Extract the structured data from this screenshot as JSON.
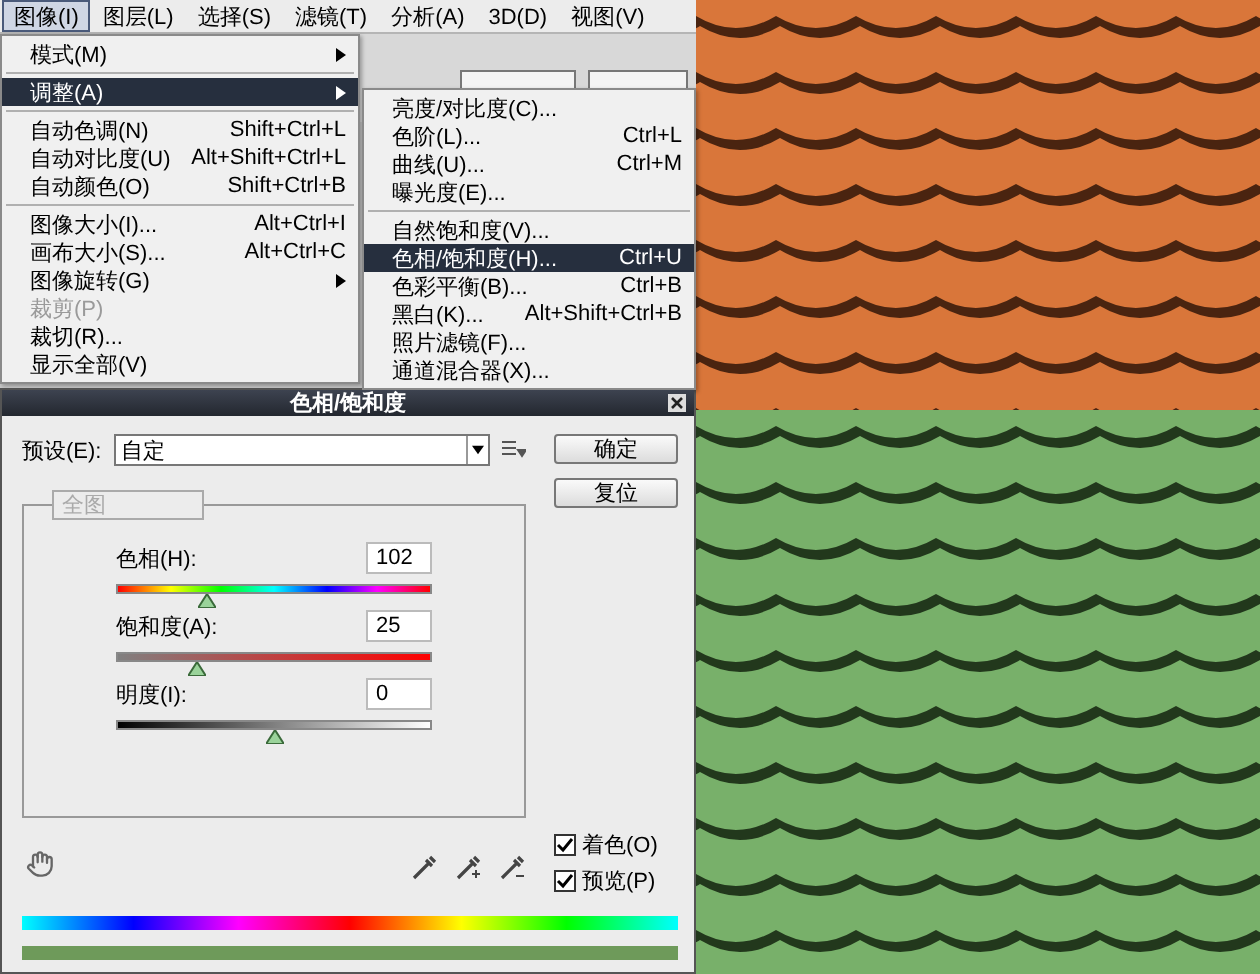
{
  "menu_bar": {
    "items": [
      {
        "label": "图像(I)",
        "selected": true
      },
      {
        "label": "图层(L)",
        "selected": false
      },
      {
        "label": "选择(S)",
        "selected": false
      },
      {
        "label": "滤镜(T)",
        "selected": false
      },
      {
        "label": "分析(A)",
        "selected": false
      },
      {
        "label": "3D(D)",
        "selected": false
      },
      {
        "label": "视图(V)",
        "selected": false
      }
    ]
  },
  "image_menu": {
    "items": [
      {
        "kind": "submenu",
        "label": "模式(M)",
        "selected": false,
        "disabled": false
      },
      {
        "kind": "separator"
      },
      {
        "kind": "submenu",
        "label": "调整(A)",
        "selected": true,
        "disabled": false
      },
      {
        "kind": "separator"
      },
      {
        "kind": "item",
        "label": "自动色调(N)",
        "shortcut": "Shift+Ctrl+L",
        "selected": false,
        "disabled": false
      },
      {
        "kind": "item",
        "label": "自动对比度(U)",
        "shortcut": "Alt+Shift+Ctrl+L",
        "selected": false,
        "disabled": false
      },
      {
        "kind": "item",
        "label": "自动颜色(O)",
        "shortcut": "Shift+Ctrl+B",
        "selected": false,
        "disabled": false
      },
      {
        "kind": "separator"
      },
      {
        "kind": "item",
        "label": "图像大小(I)...",
        "shortcut": "Alt+Ctrl+I",
        "selected": false,
        "disabled": false
      },
      {
        "kind": "item",
        "label": "画布大小(S)...",
        "shortcut": "Alt+Ctrl+C",
        "selected": false,
        "disabled": false
      },
      {
        "kind": "submenu",
        "label": "图像旋转(G)",
        "selected": false,
        "disabled": false
      },
      {
        "kind": "item",
        "label": "裁剪(P)",
        "selected": false,
        "disabled": true
      },
      {
        "kind": "item",
        "label": "裁切(R)...",
        "selected": false,
        "disabled": false
      },
      {
        "kind": "item",
        "label": "显示全部(V)",
        "selected": false,
        "disabled": false
      }
    ]
  },
  "adjust_menu": {
    "items": [
      {
        "kind": "item",
        "label": "亮度/对比度(C)...",
        "selected": false,
        "disabled": false
      },
      {
        "kind": "item",
        "label": "色阶(L)...",
        "shortcut": "Ctrl+L",
        "selected": false,
        "disabled": false
      },
      {
        "kind": "item",
        "label": "曲线(U)...",
        "shortcut": "Ctrl+M",
        "selected": false,
        "disabled": false
      },
      {
        "kind": "item",
        "label": "曝光度(E)...",
        "selected": false,
        "disabled": false
      },
      {
        "kind": "separator"
      },
      {
        "kind": "item",
        "label": "自然饱和度(V)...",
        "selected": false,
        "disabled": false
      },
      {
        "kind": "item",
        "label": "色相/饱和度(H)...",
        "shortcut": "Ctrl+U",
        "selected": true,
        "disabled": false
      },
      {
        "kind": "item",
        "label": "色彩平衡(B)...",
        "shortcut": "Ctrl+B",
        "selected": false,
        "disabled": false
      },
      {
        "kind": "item",
        "label": "黑白(K)...",
        "shortcut": "Alt+Shift+Ctrl+B",
        "selected": false,
        "disabled": false
      },
      {
        "kind": "item",
        "label": "照片滤镜(F)...",
        "selected": false,
        "disabled": false
      },
      {
        "kind": "item",
        "label": "通道混合器(X)...",
        "selected": false,
        "disabled": false
      }
    ]
  },
  "dialog": {
    "title": "色相/饱和度",
    "preset": {
      "label": "预设(E):",
      "value": "自定"
    },
    "buttons": [
      "确定",
      "复位"
    ],
    "channel": {
      "value": "全图",
      "disabled": true
    },
    "sliders": [
      {
        "kind": "hue",
        "label": "色相(H):",
        "value": "102",
        "level": 0.283
      },
      {
        "kind": "saturation",
        "label": "饱和度(A):",
        "value": "25",
        "level": 0.25
      },
      {
        "kind": "lightness",
        "label": "明度(I):",
        "value": "0",
        "level": 0.5
      }
    ],
    "checkboxes": [
      {
        "label": "着色(O)",
        "checked": true
      },
      {
        "label": "预览(P)",
        "checked": true
      }
    ]
  }
}
